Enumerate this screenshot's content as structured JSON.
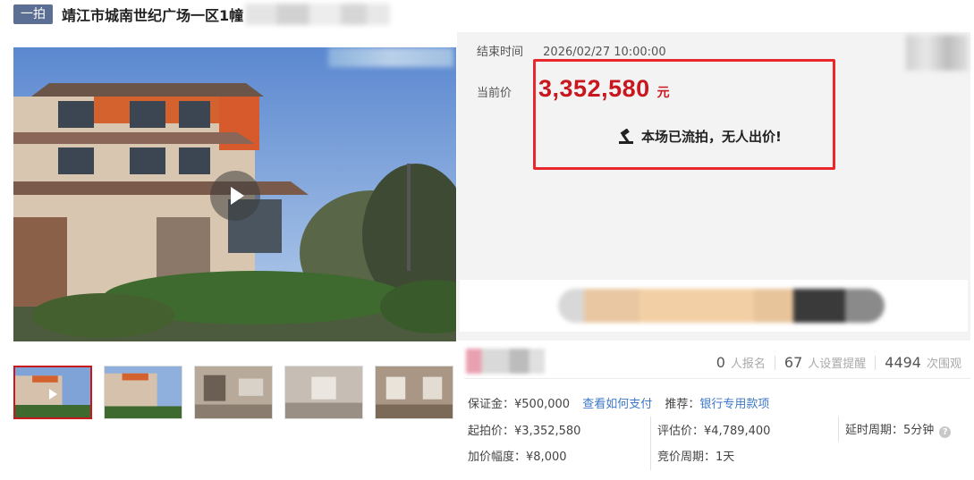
{
  "title": {
    "badge": "一拍",
    "text": "靖江市城南世纪广场一区1幢"
  },
  "price_panel": {
    "end_label": "结束时间",
    "end_time": "2026/02/27 10:00:00",
    "current_label": "当前价",
    "current_price": "3,352,580",
    "currency_unit": "元",
    "status_text": "本场已流拍，无人出价!"
  },
  "stats": {
    "signup_count": "0",
    "signup_label": "人报名",
    "reminder_count": "67",
    "reminder_label": "人设置提醒",
    "view_count": "4494",
    "view_label": "次围观"
  },
  "info": {
    "deposit_label": "保证金：",
    "deposit_value": "¥500,000",
    "deposit_link": "查看如何支付",
    "recommend_label": "推荐：",
    "recommend_link": "银行专用款项",
    "start_price_label": "起拍价：",
    "start_price_value": "¥3,352,580",
    "appraisal_label": "评估价：",
    "appraisal_value": "¥4,789,400",
    "delay_label": "延时周期：",
    "delay_value": "5分钟",
    "increment_label": "加价幅度：",
    "increment_value": "¥8,000",
    "cycle_label": "竞价周期：",
    "cycle_value": "1天"
  },
  "colors": {
    "accent_red": "#c8171e",
    "highlight_box": "#e8282d",
    "link_blue": "#3d78c7",
    "badge_bg": "#5a6f93"
  },
  "icons": {
    "play": "play-icon",
    "auction_hammer": "gavel-icon",
    "help": "question-circle-icon"
  }
}
